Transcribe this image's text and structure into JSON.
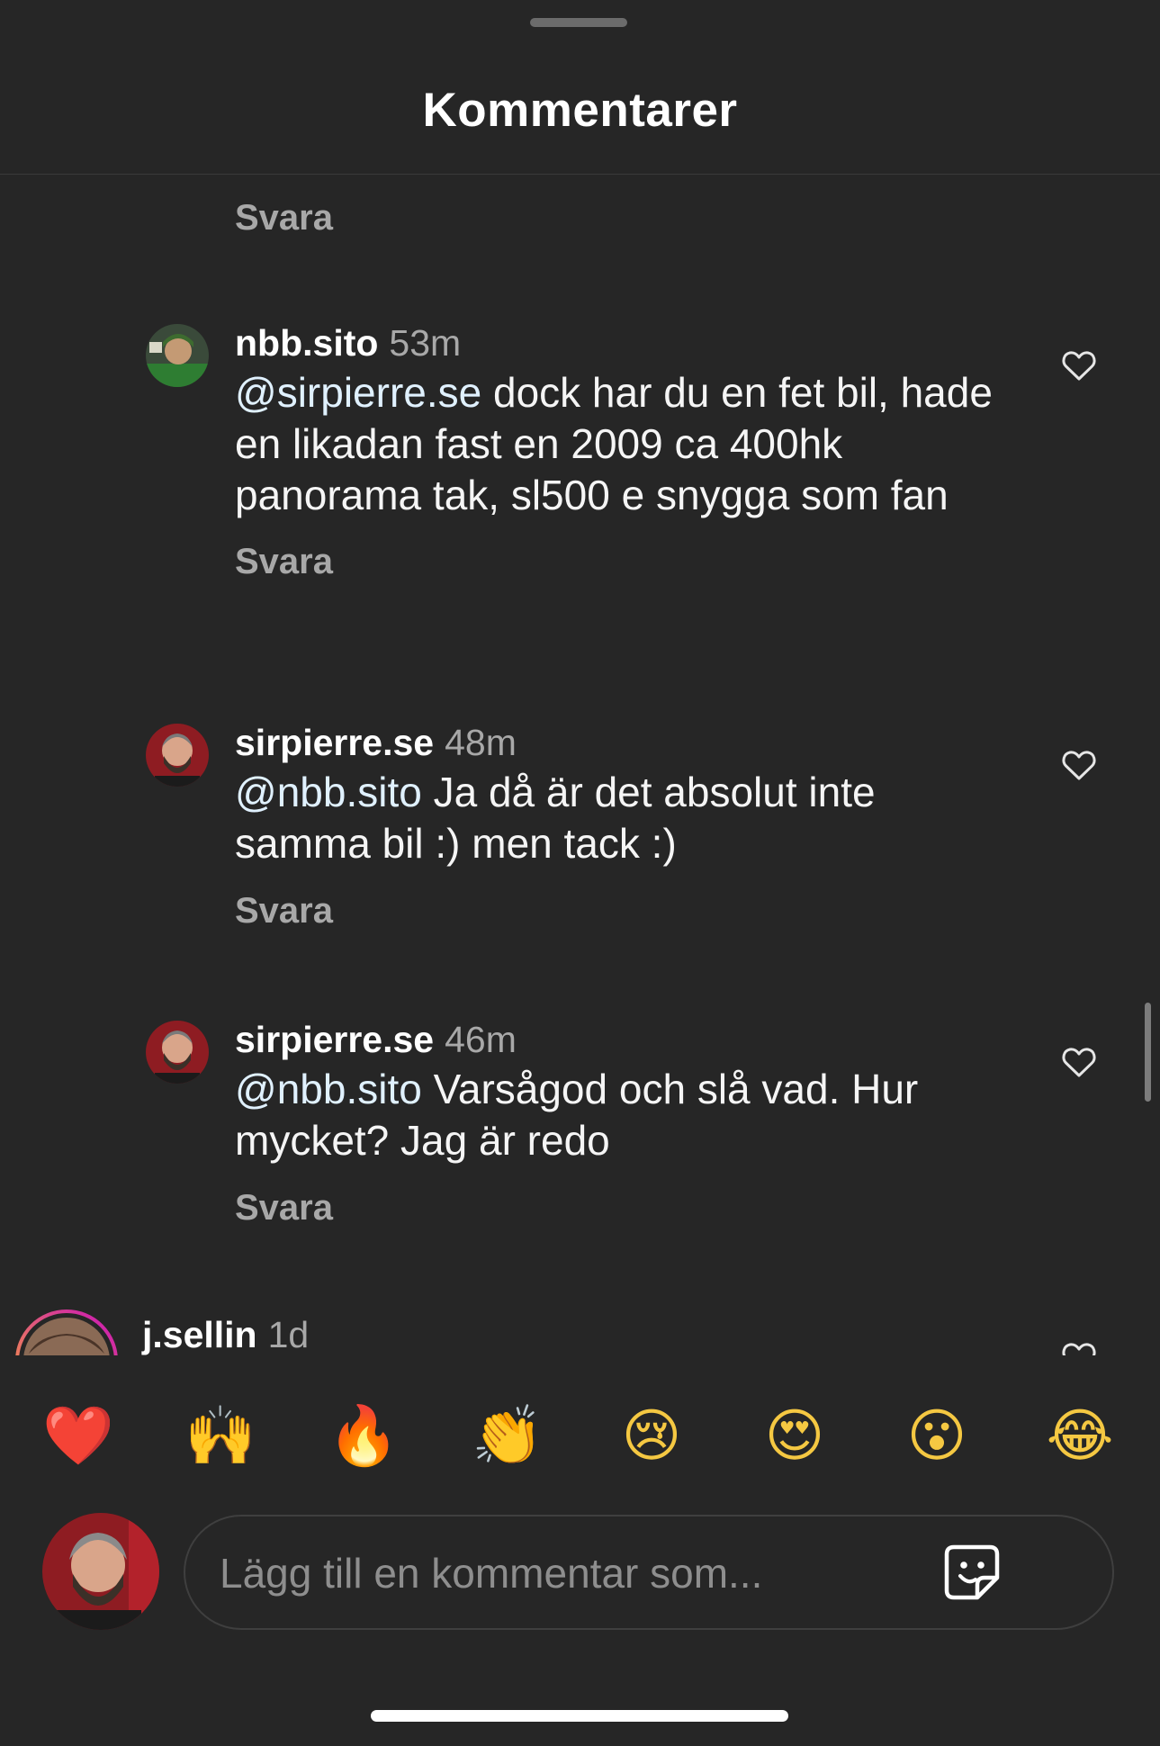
{
  "header": {
    "title": "Kommentarer"
  },
  "feed": {
    "top_reply_label": "Svara",
    "comments": [
      {
        "username": "nbb.sito",
        "time": "53m",
        "mention": "@sirpierre.se",
        "text": " dock har du en fet bil, hade en likadan fast en 2009 ca 400hk panorama tak, sl500 e snygga som fan",
        "reply_label": "Svara",
        "like_icon": "heart-outline-icon"
      },
      {
        "username": "sirpierre.se",
        "time": "48m",
        "mention": "@nbb.sito",
        "text": " Ja då är det absolut inte samma bil :) men tack :)",
        "reply_label": "Svara",
        "like_icon": "heart-outline-icon"
      },
      {
        "username": "sirpierre.se",
        "time": "46m",
        "mention": "@nbb.sito",
        "text": " Varsågod och slå vad. Hur mycket? Jag är redo",
        "reply_label": "Svara",
        "like_icon": "heart-outline-icon"
      },
      {
        "username": "j.sellin",
        "time": "1d",
        "like_icon": "heart-outline-icon"
      }
    ]
  },
  "reactions": {
    "emojis": [
      "❤️",
      "🙌",
      "🔥",
      "👏",
      "😢",
      "😍",
      "😮",
      "😂"
    ]
  },
  "composer": {
    "placeholder": "Lägg till en kommentar som...",
    "sticker_icon": "sticker-icon"
  },
  "colors": {
    "background": "#262626",
    "mention": "#e0f1ff",
    "secondary_text": "#a8a8a8",
    "story_ring_start": "#f9a23b",
    "story_ring_end": "#c913b9"
  }
}
